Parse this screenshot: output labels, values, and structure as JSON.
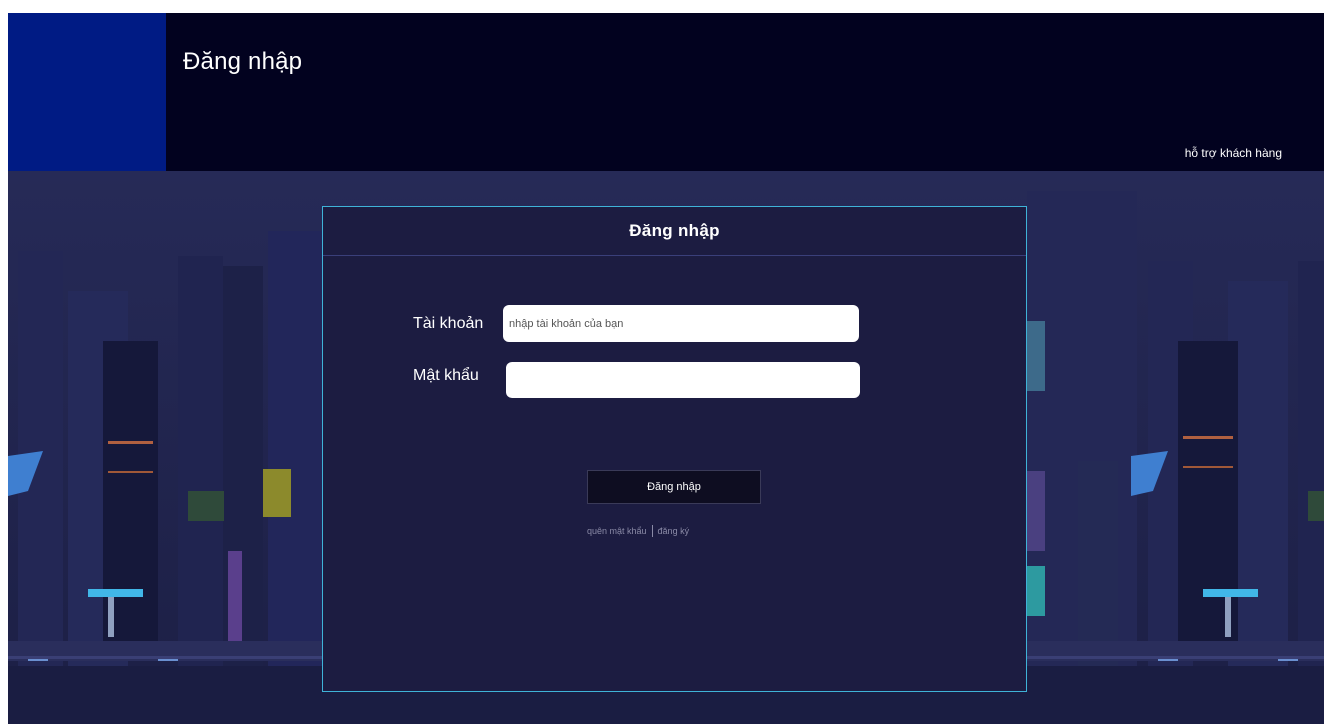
{
  "header": {
    "title": "Đăng nhập",
    "support_link": "hỗ trợ khách hàng"
  },
  "modal": {
    "title": "Đăng nhập",
    "username_label": "Tài khoản",
    "username_placeholder": "nhập tài khoản của bạn",
    "username_value": "",
    "password_label": "Mật khẩu",
    "password_value": "",
    "submit_label": "Đăng nhập",
    "forgot_link": "quên mật khẩu",
    "register_link": "đăng ký"
  },
  "colors": {
    "header_bg": "#02021f",
    "brand_block": "#001b84",
    "modal_bg": "#1c1c41",
    "modal_border": "#3fb3d8",
    "button_bg": "#0e0d21"
  }
}
